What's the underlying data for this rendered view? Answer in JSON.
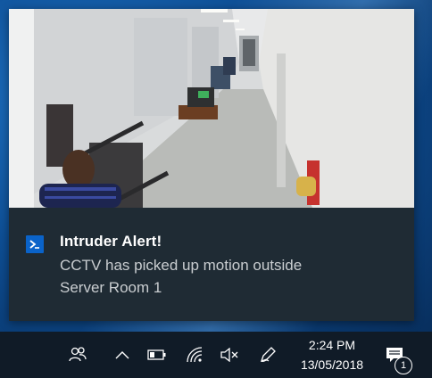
{
  "notification": {
    "title": "Intruder Alert!",
    "body_line1": "CCTV has picked up motion outside",
    "body_line2": "Server Room 1",
    "app_icon": "powershell-icon",
    "hero_image": "cctv-corridor-frame"
  },
  "taskbar": {
    "tray_icons": [
      "people-icon",
      "chevron-up-icon",
      "battery-icon",
      "wifi-icon",
      "volume-muted-icon",
      "pen-icon",
      "action-center-icon"
    ],
    "time": "2:24 PM",
    "date": "13/05/2018",
    "notification_count": "1"
  },
  "colors": {
    "toast_bg": "#1f2b34",
    "taskbar_bg": "#101b27",
    "accent": "#0a63c9"
  }
}
